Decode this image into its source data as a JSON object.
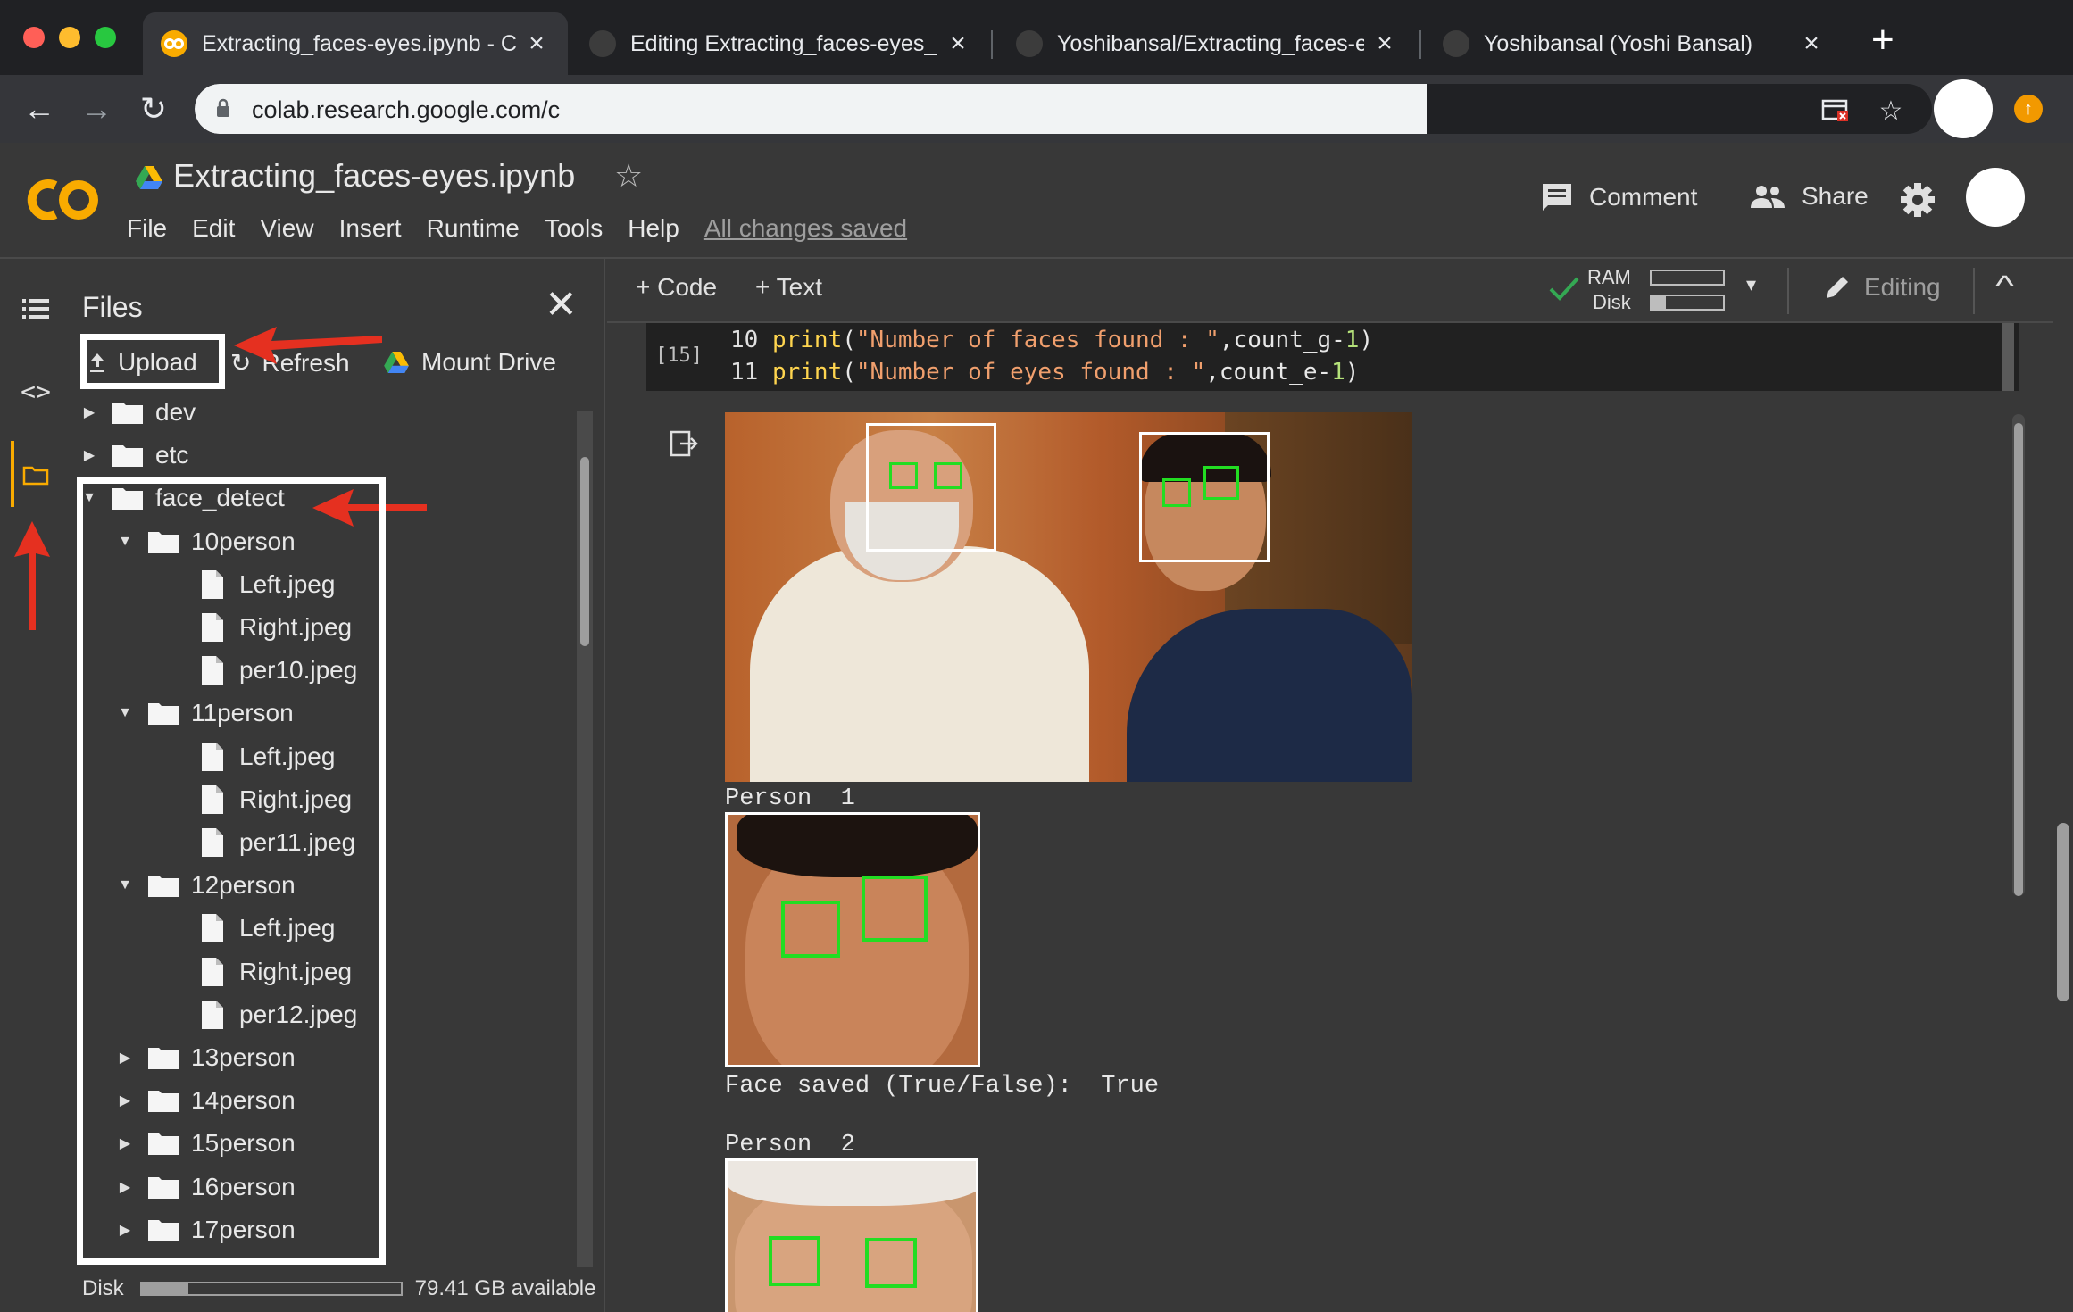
{
  "browser": {
    "tabs": [
      {
        "title": "Extracting_faces-eyes.ipynb - C",
        "favicon": "colab-icon",
        "active": true
      },
      {
        "title": "Editing Extracting_faces-eyes_fr",
        "favicon": "github-icon",
        "active": false
      },
      {
        "title": "Yoshibansal/Extracting_faces-ey",
        "favicon": "github-icon",
        "active": false
      },
      {
        "title": "Yoshibansal (Yoshi Bansal)",
        "favicon": "github-icon",
        "active": false
      }
    ],
    "new_tab_label": "+",
    "url": "colab.research.google.com/c"
  },
  "colab": {
    "notebook_title": "Extracting_faces-eyes.ipynb",
    "menu": [
      "File",
      "Edit",
      "View",
      "Insert",
      "Runtime",
      "Tools",
      "Help"
    ],
    "save_status": "All changes saved",
    "comment_label": "Comment",
    "share_label": "Share",
    "accent": "#f9ab00"
  },
  "files_panel": {
    "title": "Files",
    "upload_label": "Upload",
    "refresh_label": "Refresh",
    "mount_label": "Mount Drive",
    "tree": [
      {
        "name": "dev",
        "type": "folder",
        "expanded": false,
        "depth": 0
      },
      {
        "name": "etc",
        "type": "folder",
        "expanded": false,
        "depth": 0
      },
      {
        "name": "face_detect",
        "type": "folder",
        "expanded": true,
        "depth": 0
      },
      {
        "name": "10person",
        "type": "folder",
        "expanded": true,
        "depth": 1
      },
      {
        "name": "Left.jpeg",
        "type": "file",
        "depth": 2
      },
      {
        "name": "Right.jpeg",
        "type": "file",
        "depth": 2
      },
      {
        "name": "per10.jpeg",
        "type": "file",
        "depth": 2
      },
      {
        "name": "11person",
        "type": "folder",
        "expanded": true,
        "depth": 1
      },
      {
        "name": "Left.jpeg",
        "type": "file",
        "depth": 2
      },
      {
        "name": "Right.jpeg",
        "type": "file",
        "depth": 2
      },
      {
        "name": "per11.jpeg",
        "type": "file",
        "depth": 2
      },
      {
        "name": "12person",
        "type": "folder",
        "expanded": true,
        "depth": 1
      },
      {
        "name": "Left.jpeg",
        "type": "file",
        "depth": 2
      },
      {
        "name": "Right.jpeg",
        "type": "file",
        "depth": 2
      },
      {
        "name": "per12.jpeg",
        "type": "file",
        "depth": 2
      },
      {
        "name": "13person",
        "type": "folder",
        "expanded": false,
        "depth": 1
      },
      {
        "name": "14person",
        "type": "folder",
        "expanded": false,
        "depth": 1
      },
      {
        "name": "15person",
        "type": "folder",
        "expanded": false,
        "depth": 1
      },
      {
        "name": "16person",
        "type": "folder",
        "expanded": false,
        "depth": 1
      },
      {
        "name": "17person",
        "type": "folder",
        "expanded": false,
        "depth": 1
      }
    ],
    "disk_label": "Disk",
    "disk_available": "79.41 GB available",
    "disk_used_fraction": 0.18
  },
  "notebook": {
    "add_code_label": "Code",
    "add_text_label": "Text",
    "ram_label": "RAM",
    "disk_label": "Disk",
    "ram_fraction": 0.0,
    "disk_fraction": 0.2,
    "editing_label": "Editing",
    "cell": {
      "execution_count": "[15]",
      "lines": [
        {
          "number": "10",
          "fn": "print",
          "str": "\"Number of faces found : \"",
          "var": "count_g",
          "num": "1"
        },
        {
          "number": "11",
          "fn": "print",
          "str": "\"Number of eyes found : \"",
          "var": "count_e",
          "num": "1"
        }
      ]
    },
    "output": {
      "person1_label": "Person  1",
      "face_saved_label": "Face saved (True/False):  True",
      "person2_label": "Person  2"
    },
    "face_box_color": "#ffffff",
    "eye_box_color": "#22dd22"
  }
}
